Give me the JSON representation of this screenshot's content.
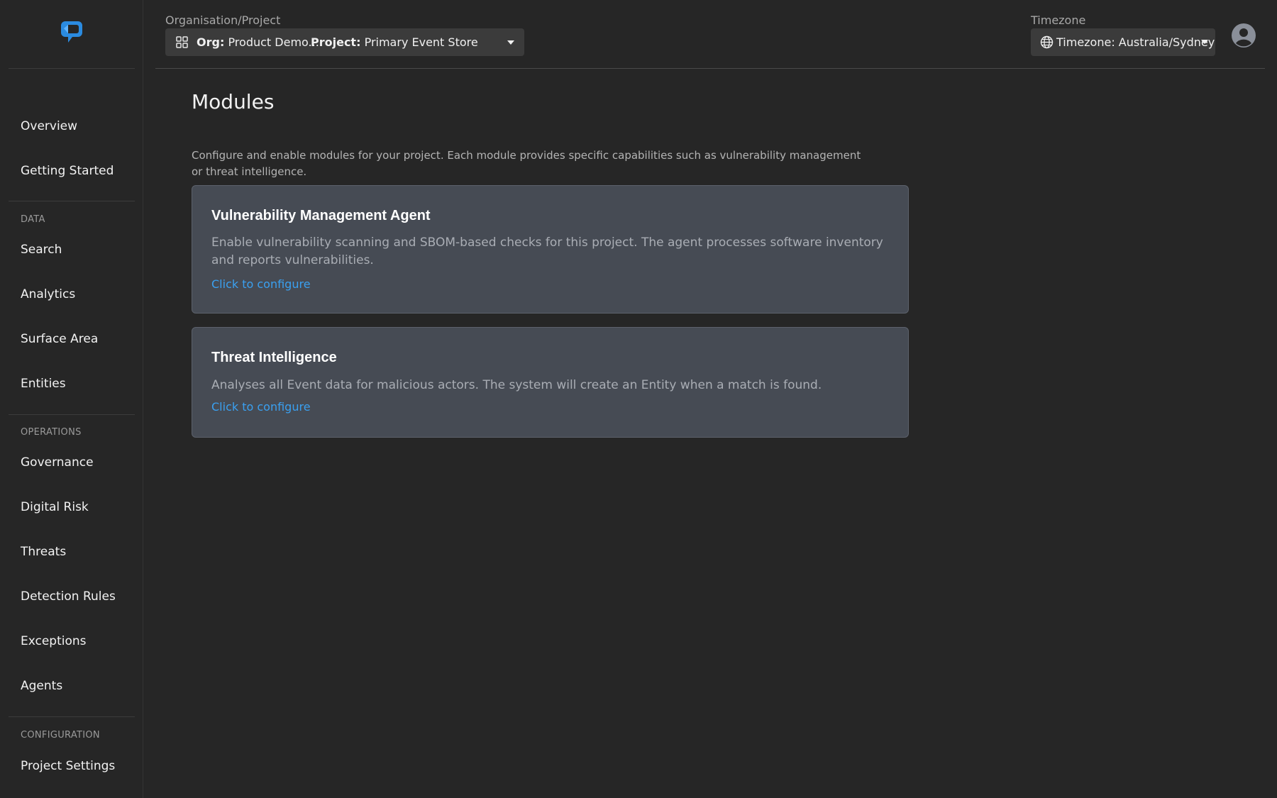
{
  "brand": {
    "accent": "#3aa0f0",
    "logo_color": "#2b8be0"
  },
  "sidebar": {
    "top_items": [
      {
        "label": "Overview"
      },
      {
        "label": "Getting Started"
      }
    ],
    "sections": [
      {
        "title": "DATA",
        "items": [
          {
            "label": "Search"
          },
          {
            "label": "Analytics"
          },
          {
            "label": "Surface Area"
          },
          {
            "label": "Entities"
          }
        ]
      },
      {
        "title": "OPERATIONS",
        "items": [
          {
            "label": "Governance"
          },
          {
            "label": "Digital Risk"
          },
          {
            "label": "Threats"
          },
          {
            "label": "Detection Rules"
          },
          {
            "label": "Exceptions"
          },
          {
            "label": "Agents"
          }
        ]
      },
      {
        "title": "CONFIGURATION",
        "items": [
          {
            "label": "Project Settings"
          }
        ]
      }
    ]
  },
  "header": {
    "org_project_label": "Organisation/Project",
    "org_prefix": "Org:",
    "org_value": "Product Demo...",
    "project_prefix": "Project:",
    "project_value": "Primary Event Store",
    "timezone_label": "Timezone",
    "timezone_value": "Timezone: Australia/Sydney"
  },
  "main": {
    "title": "Modules",
    "description": "Configure and enable modules for your project. Each module provides specific capabilities such as vulnerability management or threat intelligence.",
    "modules": [
      {
        "title": "Vulnerability Management Agent",
        "description": "Enable vulnerability scanning and SBOM-based checks for this project. The agent processes software inventory and reports vulnerabilities.",
        "link": "Click to configure"
      },
      {
        "title": "Threat Intelligence",
        "description": "Analyses all Event data for malicious actors. The system will create an Entity when a match is found.",
        "link": "Click to configure"
      }
    ]
  }
}
